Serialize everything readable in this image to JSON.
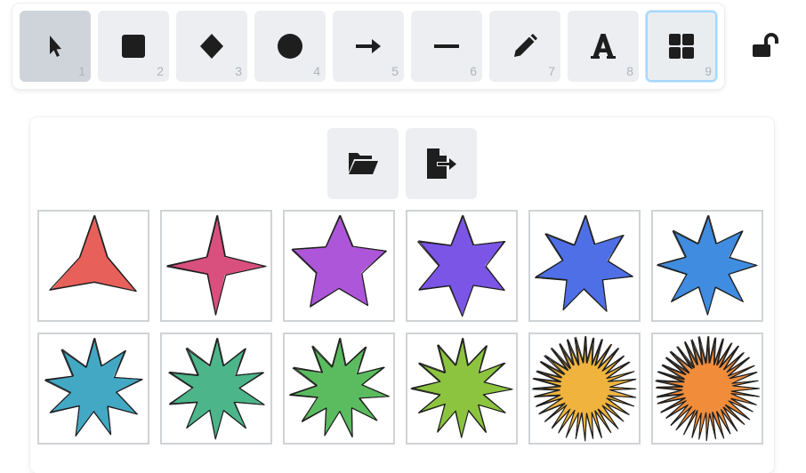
{
  "toolbar": {
    "tools": [
      {
        "name": "selection",
        "icon": "cursor-arrow-icon",
        "key": "1"
      },
      {
        "name": "rectangle",
        "icon": "square-icon",
        "key": "2"
      },
      {
        "name": "diamond",
        "icon": "diamond-icon",
        "key": "3"
      },
      {
        "name": "ellipse",
        "icon": "circle-icon",
        "key": "4"
      },
      {
        "name": "arrow",
        "icon": "arrow-right-icon",
        "key": "5"
      },
      {
        "name": "line",
        "icon": "line-icon",
        "key": "6"
      },
      {
        "name": "draw",
        "icon": "pencil-icon",
        "key": "7"
      },
      {
        "name": "text",
        "icon": "text-A-icon",
        "key": "8"
      },
      {
        "name": "library",
        "icon": "grid-icon",
        "key": "9"
      }
    ],
    "active_tool": "selection",
    "selected_tool": "library",
    "lock_icon": "unlocked-padlock-icon"
  },
  "library_panel": {
    "actions": [
      {
        "name": "load",
        "icon": "open-folder-icon"
      },
      {
        "name": "export",
        "icon": "file-export-icon"
      }
    ],
    "items": [
      {
        "points": 3,
        "color": "#e8605a"
      },
      {
        "points": 4,
        "color": "#d94f7e"
      },
      {
        "points": 5,
        "color": "#ad56d9"
      },
      {
        "points": 6,
        "color": "#7a55e6"
      },
      {
        "points": 7,
        "color": "#4f6fe6"
      },
      {
        "points": 8,
        "color": "#3f8ce0"
      },
      {
        "points": 9,
        "color": "#43a8c4"
      },
      {
        "points": 10,
        "color": "#4cb58a"
      },
      {
        "points": 11,
        "color": "#5bbc5f"
      },
      {
        "points": 12,
        "color": "#8cc43f"
      },
      {
        "points": 36,
        "color": "#f0b43e"
      },
      {
        "points": 40,
        "color": "#f08c3a"
      }
    ]
  }
}
